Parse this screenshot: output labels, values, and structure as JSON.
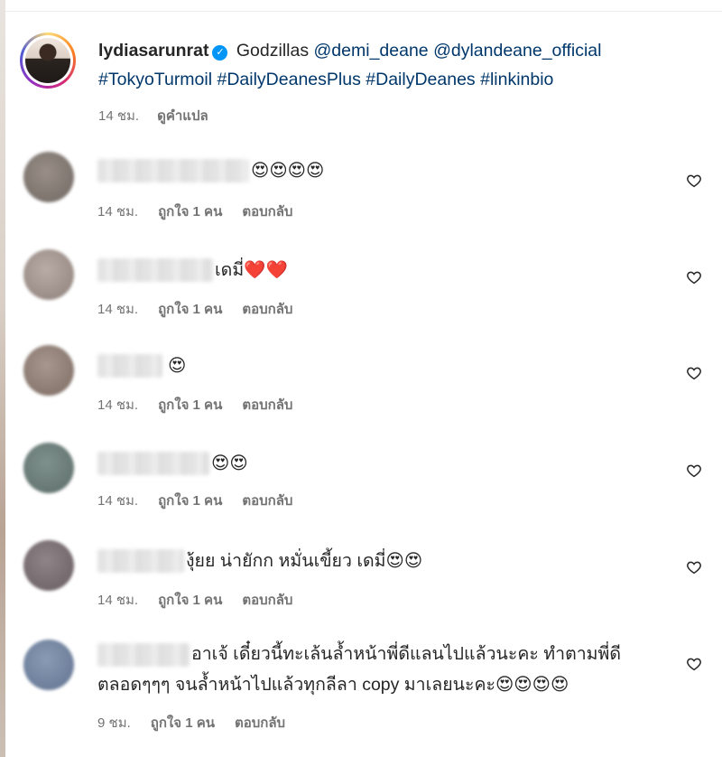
{
  "caption": {
    "username": "lydiasarunrat",
    "text_before": "Godzillas",
    "mentions": [
      "@demi_deane",
      "@dylandeane_official"
    ],
    "hashtags": [
      "#TokyoTurmoil",
      "#DailyDeanesPlus",
      "#DailyDeanes",
      "#linkinbio"
    ],
    "time": "14 ชม.",
    "translate_label": "ดูคำแปล"
  },
  "labels": {
    "likes": "ถูกใจ 1 คน",
    "reply": "ตอบกลับ"
  },
  "comments": [
    {
      "text": "😍😍😍😍",
      "time": "14 ชม."
    },
    {
      "text": "เดมี่❤️❤️",
      "time": "14 ชม."
    },
    {
      "text": "😍",
      "time": "14 ชม."
    },
    {
      "text": "😍😍",
      "time": "14 ชม."
    },
    {
      "text": "งุ้ยย น่ายักก หมั่นเขี้ยว เดมี่😍😍",
      "time": "14 ชม."
    },
    {
      "text_line1": "อาเจ้ เดี๋ยวนี้ทะเล้นล้ำหน้าพี่ดีแลนไปแล้วนะคะ ทำตามพี่ดี",
      "text_line2": "ตลอดๆๆๆ จนล้ำหน้าไปแล้วทุกลีลา copy มาเลยนะคะ😍😍😍😍",
      "time": "9 ชม."
    }
  ],
  "icons": {
    "verified": "verified-badge-icon",
    "like": "heart-outline-icon"
  },
  "colors": {
    "link": "#00376b",
    "meta": "#737373",
    "verified": "#0095f6"
  }
}
